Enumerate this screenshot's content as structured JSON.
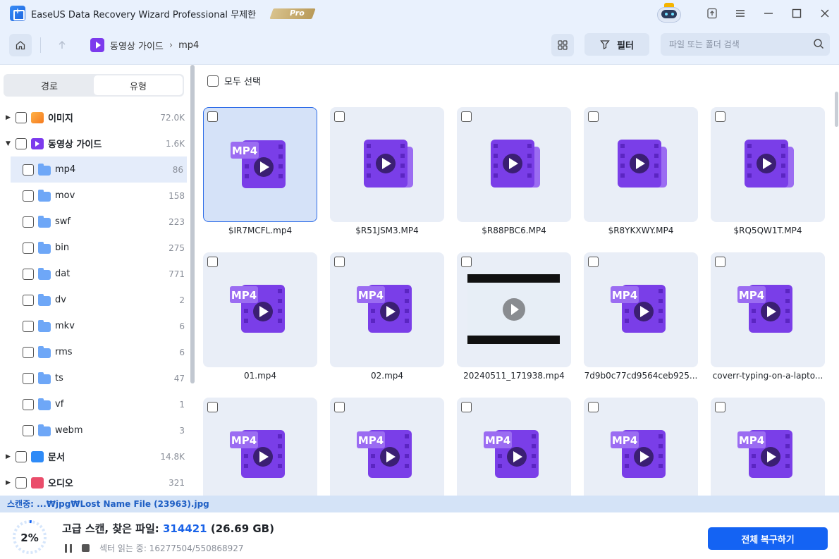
{
  "app": {
    "title": "EaseUS Data Recovery Wizard Professional 무제한",
    "badge": "Pro",
    "accent_color": "#1463f3"
  },
  "toolbar": {
    "breadcrumb": [
      "동영상 가이드",
      "mp4"
    ],
    "filter_label": "필터",
    "search_placeholder": "파일 또는 폴더 검색"
  },
  "sidebar": {
    "tabs": [
      {
        "label": "경로",
        "active": false
      },
      {
        "label": "유형",
        "active": true
      }
    ],
    "categories": [
      {
        "name": "이미지",
        "count": "72.0K",
        "icon": "image-icon",
        "expanded": false
      },
      {
        "name": "동영상 가이드",
        "count": "1.6K",
        "icon": "video-icon",
        "expanded": true
      },
      {
        "name": "문서",
        "count": "14.8K",
        "icon": "document-icon",
        "expanded": false
      },
      {
        "name": "오디오",
        "count": "321",
        "icon": "audio-icon",
        "expanded": false
      }
    ],
    "subfolders": [
      {
        "name": "mp4",
        "count": "86",
        "selected": true
      },
      {
        "name": "mov",
        "count": "158"
      },
      {
        "name": "swf",
        "count": "223"
      },
      {
        "name": "bin",
        "count": "275"
      },
      {
        "name": "dat",
        "count": "771"
      },
      {
        "name": "dv",
        "count": "2"
      },
      {
        "name": "mkv",
        "count": "6"
      },
      {
        "name": "rms",
        "count": "6"
      },
      {
        "name": "ts",
        "count": "47"
      },
      {
        "name": "vf",
        "count": "1"
      },
      {
        "name": "webm",
        "count": "3"
      }
    ]
  },
  "main": {
    "select_all_label": "모두 선택",
    "files": [
      {
        "name": "$IR7MCFL.mp4",
        "thumb": "mp4-file-icon",
        "selected": true
      },
      {
        "name": "$R51JSM3.MP4",
        "thumb": "video-file-icon"
      },
      {
        "name": "$R88PBC6.MP4",
        "thumb": "video-file-icon"
      },
      {
        "name": "$R8YKXWY.MP4",
        "thumb": "video-file-icon"
      },
      {
        "name": "$RQ5QW1T.MP4",
        "thumb": "video-file-icon"
      },
      {
        "name": "01.mp4",
        "thumb": "mp4-file-icon"
      },
      {
        "name": "02.mp4",
        "thumb": "mp4-file-icon"
      },
      {
        "name": "20240511_171938.mp4",
        "thumb": "video-preview"
      },
      {
        "name": "7d9b0c77cd9564ceb925...",
        "thumb": "mp4-file-icon"
      },
      {
        "name": "coverr-typing-on-a-lapto...",
        "thumb": "mp4-file-icon"
      },
      {
        "name": "",
        "thumb": "mp4-file-icon"
      },
      {
        "name": "",
        "thumb": "mp4-file-icon"
      },
      {
        "name": "",
        "thumb": "mp4-file-icon"
      },
      {
        "name": "",
        "thumb": "mp4-file-icon"
      },
      {
        "name": "",
        "thumb": "mp4-file-icon"
      }
    ]
  },
  "status": {
    "scanning_path": "스캔중: ...₩jpg₩Lost Name File (23963).jpg",
    "progress_percent": 2,
    "progress_label": "2%",
    "scan_prefix": "고급 스캔, 찾은 파일: ",
    "found_count": "314421",
    "found_size": " (26.69 GB)",
    "sector_text": "섹터 읽는 중: 16277504/550868927",
    "recover_all_label": "전체 복구하기"
  }
}
